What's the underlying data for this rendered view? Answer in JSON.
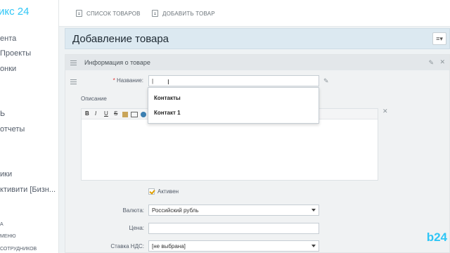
{
  "sidebar": {
    "logo_word": "икс",
    "logo_num": "24",
    "items": [
      "ента",
      "Проекты",
      "онки",
      "Ь",
      "отчеты",
      "ики",
      "ктивити [Бизн..."
    ],
    "small_items": [
      "А",
      "МЕНЮ",
      "СОТРУДНИКОВ"
    ]
  },
  "topbar": {
    "tabs": [
      {
        "label": "СПИСОК ТОВАРОВ",
        "icon": "list-icon"
      },
      {
        "label": "ДОБАВИТЬ ТОВАР",
        "icon": "add-document-icon"
      }
    ]
  },
  "page": {
    "title": "Добавление товара",
    "menu_icon": "≡▾"
  },
  "section": {
    "title": "Информация о товаре"
  },
  "form": {
    "name_label": "Название:",
    "name_value": "|",
    "description_label": "Описание",
    "toolbar_buttons": [
      "B",
      "I",
      "U",
      "S"
    ],
    "active_label": "Активен",
    "currency_label": "Валюта:",
    "currency_value": "Российский рубль",
    "price_label": "Цена:",
    "price_value": "",
    "vat_label": "Ставка НДС:",
    "vat_value": "[не выбрана]"
  },
  "dropdown": {
    "items": [
      "Контакты",
      "Контакт 1"
    ]
  },
  "brand": {
    "watermark": "b24"
  },
  "colors": {
    "accent": "#2fc6f6",
    "title_bar": "#dce9f1",
    "checkbox_tick": "#e0a000",
    "required": "#e02b2b"
  }
}
